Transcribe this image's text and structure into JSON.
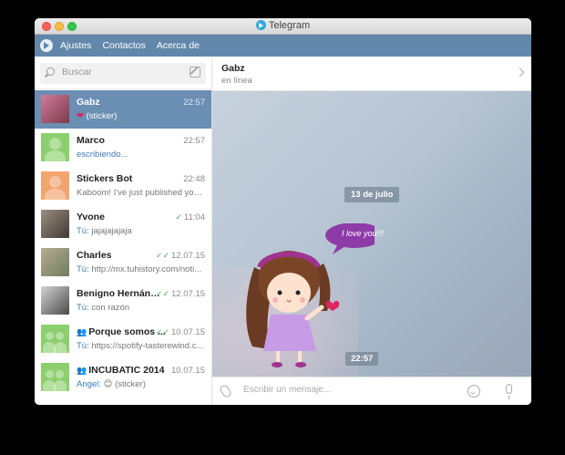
{
  "window": {
    "title": "Telegram"
  },
  "menubar": {
    "items": [
      "Ajustes",
      "Contactos",
      "Acerca de"
    ]
  },
  "search": {
    "placeholder": "Buscar"
  },
  "chats": [
    {
      "name": "Gabz",
      "time": "22:57",
      "prefix": "",
      "message": "(sticker)",
      "heart": "❤",
      "active": true,
      "checks": ""
    },
    {
      "name": "Marco",
      "time": "22:57",
      "prefix": "",
      "message": "escribiendo...",
      "heart": "",
      "active": false,
      "checks": ""
    },
    {
      "name": "Stickers Bot",
      "time": "22:48",
      "prefix": "",
      "message": "Kaboom! I've just published you...",
      "heart": "",
      "active": false,
      "checks": ""
    },
    {
      "name": "Yvone",
      "time": "11:04",
      "prefix": "Tú:",
      "message": " jajajajajaja",
      "heart": "",
      "active": false,
      "checks": "✓"
    },
    {
      "name": "Charles",
      "time": "12.07.15",
      "prefix": "Tú:",
      "message": " http://mx.tuhistory.com/noti...",
      "heart": "",
      "active": false,
      "checks": "✓✓"
    },
    {
      "name": "Benigno Hernández",
      "time": "12.07.15",
      "prefix": "Tú:",
      "message": " con razón",
      "heart": "",
      "active": false,
      "checks": "✓✓"
    },
    {
      "name": "Porque somos ...",
      "time": "10.07.15",
      "prefix": "Tú:",
      "message": " https://spotify-tasterewind.c...",
      "heart": "",
      "active": false,
      "checks": "✓✓",
      "group": true
    },
    {
      "name": "INCUBATIC 2014",
      "time": "10.07.15",
      "prefix": "Angel:",
      "message": " 😊 (sticker)",
      "heart": "",
      "active": false,
      "checks": "",
      "group": true
    }
  ],
  "header": {
    "name": "Gabz",
    "status": "en línea"
  },
  "conversation": {
    "date": "13 de julio",
    "time": "22:57",
    "sticker_text": "I love you!!!"
  },
  "composer": {
    "placeholder": "Escribir un mensaje..."
  },
  "colors": {
    "menubar": "#6287ab",
    "active_chat": "#6b8eb3",
    "link_blue": "#3e7bb6",
    "check_green": "#4caf50"
  }
}
